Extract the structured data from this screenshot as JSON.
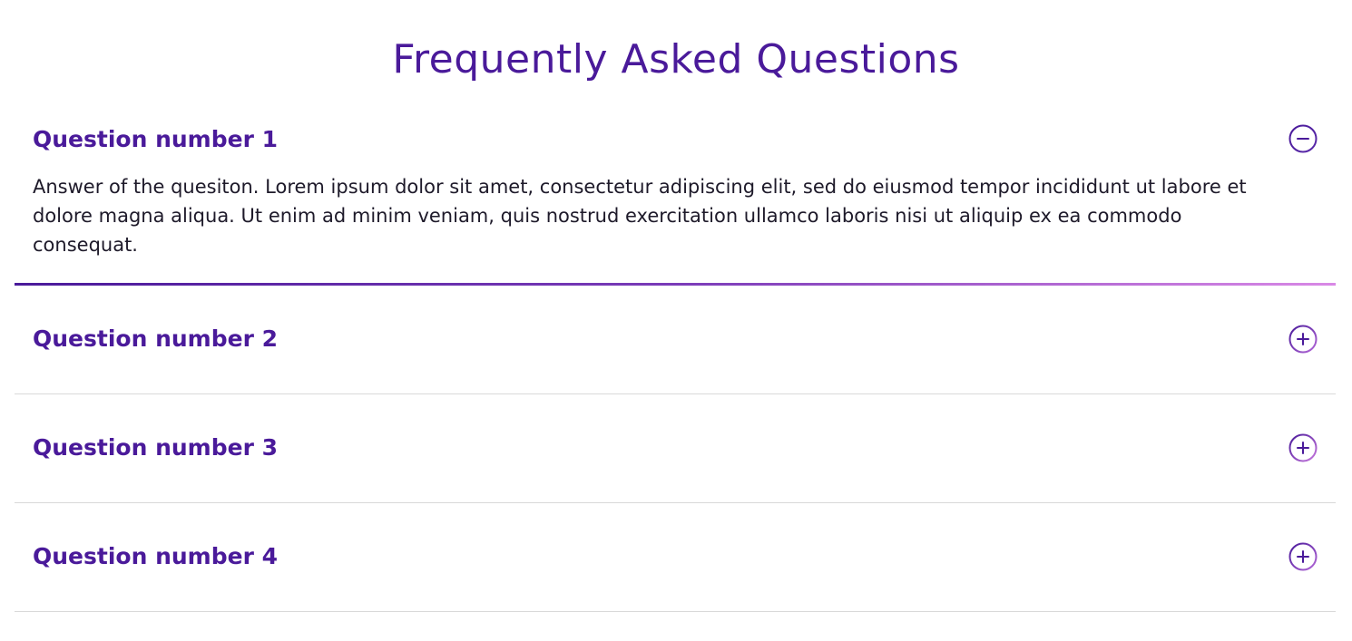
{
  "page": {
    "title": "Frequently Asked Questions"
  },
  "colors": {
    "accent": "#4a1a9a",
    "gradient_end": "#d989e6",
    "text": "#1e1a2a",
    "divider": "#d9d9d9"
  },
  "faq": {
    "items": [
      {
        "question": "Question number 1",
        "answer": "Answer of the quesiton. Lorem ipsum dolor sit amet, consectetur adipiscing elit, sed do eiusmod tempor incididunt ut labore et dolore magna aliqua. Ut enim ad minim veniam, quis nostrud exercitation ullamco laboris nisi ut aliquip ex ea commodo consequat.",
        "expanded": true,
        "icon": "minus-circle-icon"
      },
      {
        "question": "Question number 2",
        "expanded": false,
        "icon": "plus-circle-icon"
      },
      {
        "question": "Question number 3",
        "expanded": false,
        "icon": "plus-circle-icon"
      },
      {
        "question": "Question number 4",
        "expanded": false,
        "icon": "plus-circle-icon"
      }
    ]
  }
}
